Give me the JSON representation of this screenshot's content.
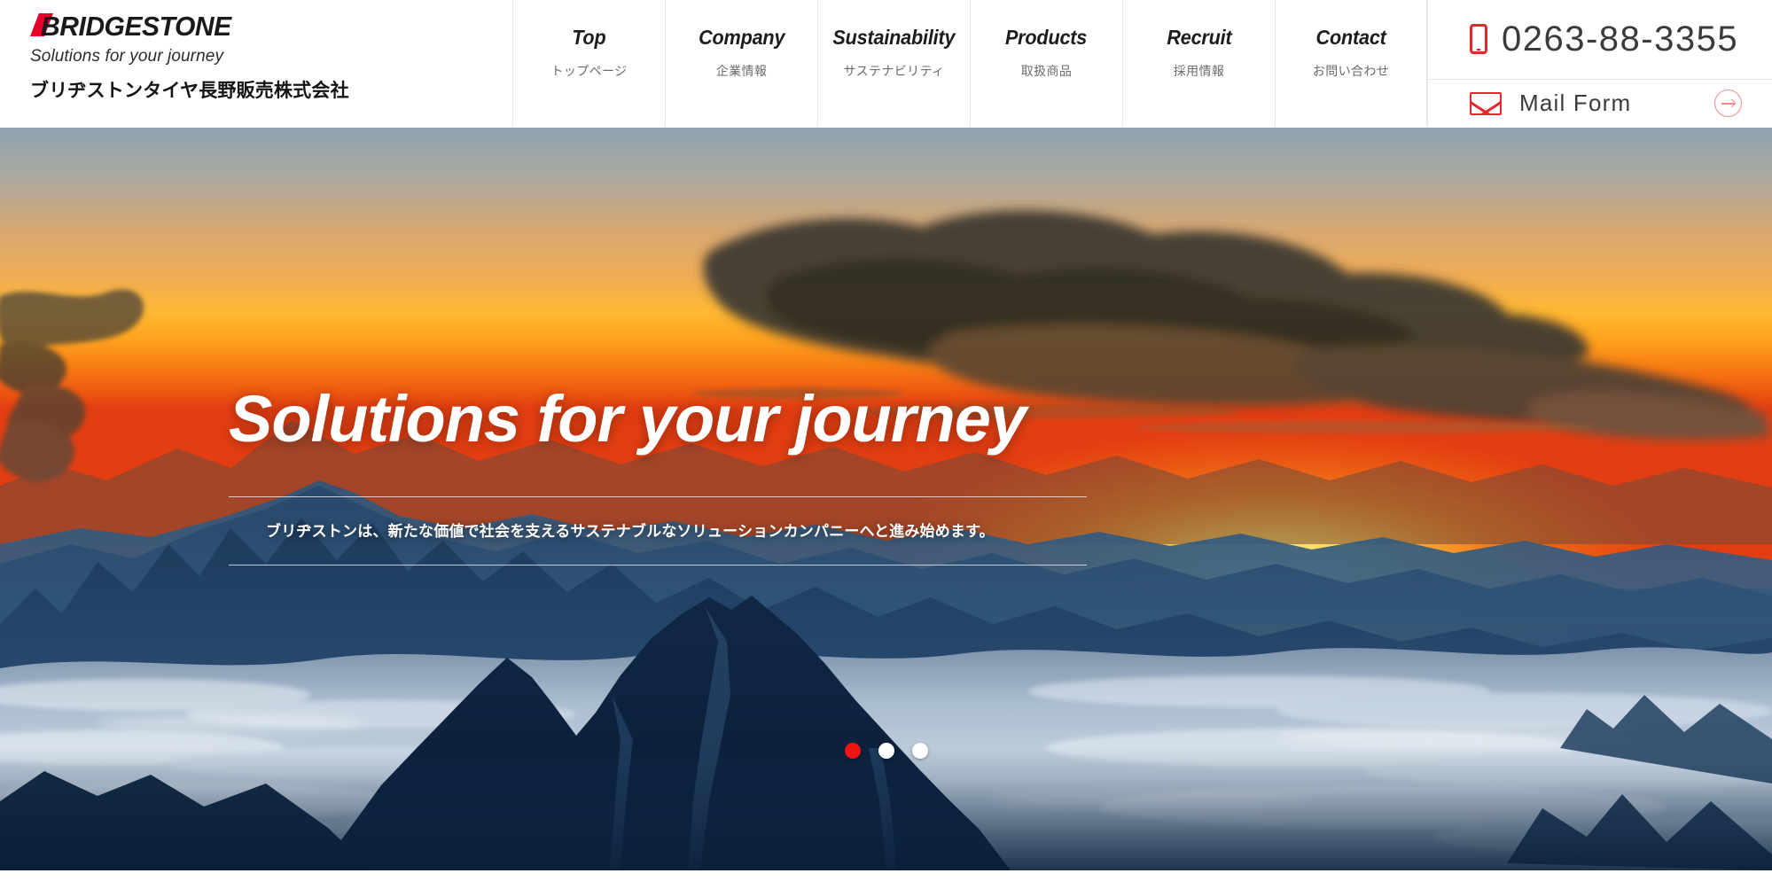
{
  "header": {
    "logo": {
      "wordmark": "BRIDGESTONE",
      "tagline": "Solutions for your journey",
      "company_name": "ブリヂストンタイヤ長野販売株式会社",
      "mark_color": "#e4002b"
    },
    "nav": [
      {
        "en": "Top",
        "ja": "トップページ"
      },
      {
        "en": "Company",
        "ja": "企業情報"
      },
      {
        "en": "Sustainability",
        "ja": "サステナビリティ"
      },
      {
        "en": "Products",
        "ja": "取扱商品"
      },
      {
        "en": "Recruit",
        "ja": "採用情報"
      },
      {
        "en": "Contact",
        "ja": "お問い合わせ"
      }
    ],
    "contact": {
      "phone_icon": "smartphone-icon",
      "phone_number": "0263-88-3355",
      "mail_icon": "envelope-icon",
      "mail_label": "Mail Form",
      "mail_arrow_icon": "arrow-right-circle-icon",
      "accent_color": "#e8252a"
    }
  },
  "hero": {
    "title": "Solutions for your journey",
    "subtitle": "ブリヂストンは、新たな価値で社会を支えるサステナブルなソリューションカンパニーへと進み始めます。",
    "carousel": {
      "slide_count": 3,
      "active_index": 0,
      "active_color": "#ef1515",
      "inactive_color": "#ffffff"
    },
    "scene": {
      "description": "Sunrise above a sea of clouds with a dark mountain silhouette",
      "sky_top_color": "#93a3ac",
      "sky_mid_color": "#f5a23a",
      "sun_glow_color": "#ffd24a",
      "horizon_color": "#e8491c",
      "ridge_color": "#2c4f70",
      "cloud_color": "#cfd9e4",
      "foreground_color": "#0d2038"
    }
  }
}
